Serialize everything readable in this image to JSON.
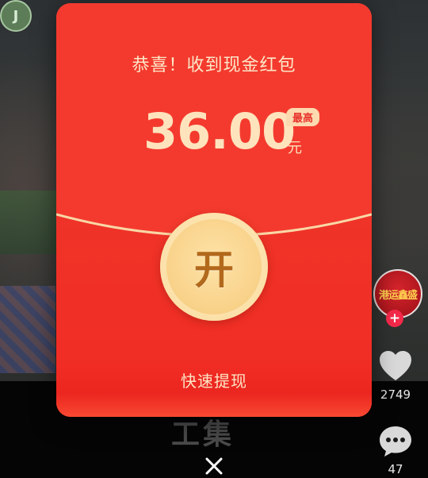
{
  "badge": {
    "letter": "J"
  },
  "red_packet": {
    "title": "恭喜！收到现金红包",
    "amount": "36.00",
    "unit": "元",
    "max_tag": "最高",
    "open_label": "开",
    "withdraw_label": "快速提现"
  },
  "sidebar": {
    "creator_avatar_text": "港运鑫盛",
    "follow_symbol": "+",
    "likes": "2749",
    "comments": "47"
  },
  "video": {
    "caption": "工集"
  },
  "close_symbol": "✕",
  "colors": {
    "envelope_red": "#f43a2e",
    "gold_text": "#fee3bd",
    "coin_gold": "#f8cf85",
    "follow_red": "#f5294a"
  }
}
